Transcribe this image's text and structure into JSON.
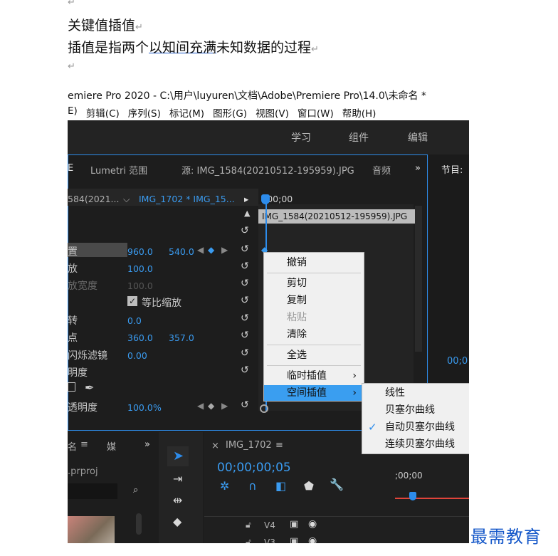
{
  "doc": {
    "line_heading": "关键值插值",
    "line2_before": "插值是指两个",
    "line2_underlined": "以知间充满",
    "line2_after": "未知数据的过程",
    "para_mark": "↵"
  },
  "window": {
    "title": "emiere Pro 2020 - C:\\用户\\luyuren\\文档\\Adobe\\Premiere Pro\\14.0\\未命名 *",
    "menu": [
      "E)",
      "剪辑(C)",
      "序列(S)",
      "标记(M)",
      "图形(G)",
      "视图(V)",
      "窗口(W)",
      "帮助(H)"
    ]
  },
  "workspace_tabs": [
    "学习",
    "组件",
    "编辑"
  ],
  "panel_tabs": {
    "left_stub": "E",
    "lumetri": "Lumetri 范围",
    "source": "源: IMG_1584(20210512-195959).JPG",
    "audio": "音频",
    "more": "»",
    "program": "节目:"
  },
  "sub_tabs": {
    "clip_a": "584(2021...",
    "clip_b": "IMG_1702 * IMG_15...",
    "timecode": ";00;00",
    "clip_name": "IMG_1584(20210512-195959).JPG"
  },
  "effect_rows": [
    {
      "label": "置",
      "v1": "960.0",
      "v2": "540.0"
    },
    {
      "label": "放",
      "v1": "100.0",
      "v2": ""
    },
    {
      "label": "放宽度",
      "v1": "100.0",
      "v2": ""
    },
    {
      "label": "等比缩放",
      "v1": "",
      "v2": ""
    },
    {
      "label": "转",
      "v1": "0.0",
      "v2": ""
    },
    {
      "label": "点",
      "v1": "360.0",
      "v2": "357.0"
    },
    {
      "label": "闪烁滤镜",
      "v1": "0.00",
      "v2": ""
    },
    {
      "label": "明度",
      "v1": "",
      "v2": ""
    },
    {
      "label": "透明度",
      "v1": "100.0",
      "v2": "%"
    }
  ],
  "context_menu": {
    "items": [
      "撤销",
      "剪切",
      "复制",
      "粘贴",
      "清除",
      "全选",
      "临时插值",
      "空间插值"
    ]
  },
  "submenu": {
    "items": [
      "线性",
      "贝塞尔曲线",
      "自动贝塞尔曲线",
      "连续贝塞尔曲线"
    ],
    "checked": "自动贝塞尔曲线"
  },
  "bottom": {
    "project_tab": "名",
    "media_tab": "媒",
    "more": "»",
    "project_file": ".prproj",
    "sequence_tab": "IMG_1702",
    "timecode": "00;00;00;05",
    "ruler": ";00;00",
    "tracks": [
      "V4",
      "V3"
    ],
    "program_time": "00;0"
  },
  "watermark": "最需教育",
  "colors": {
    "accent": "#2d8ceb",
    "value_blue": "#3a9bf0",
    "highlight": "#3a9ef0",
    "bg": "#1e1e1e"
  }
}
